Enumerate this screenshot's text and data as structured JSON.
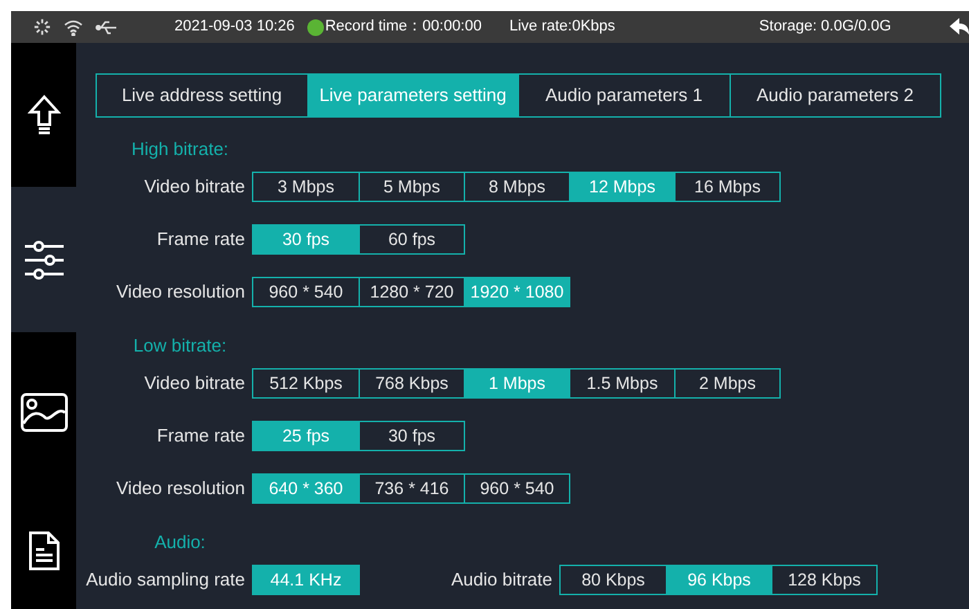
{
  "status_bar": {
    "datetime": "2021-09-03 10:26",
    "record_time": "Record time：00:00:00",
    "live_rate": "Live rate:0Kbps",
    "storage": "Storage: 0.0G/0.0G"
  },
  "sidebar": {
    "items": [
      {
        "kind": "upload",
        "selected": false
      },
      {
        "kind": "sliders",
        "selected": true
      },
      {
        "kind": "image",
        "selected": false
      },
      {
        "kind": "document",
        "selected": false
      }
    ]
  },
  "tabs": [
    {
      "label": "Live address setting",
      "selected": false
    },
    {
      "label": "Live parameters setting",
      "selected": true
    },
    {
      "label": "Audio parameters 1",
      "selected": false
    },
    {
      "label": "Audio parameters 2",
      "selected": false
    }
  ],
  "sections": [
    {
      "title": "High bitrate:",
      "rows": [
        {
          "fields": [
            {
              "label": "Video bitrate",
              "options": [
                {
                  "label": "3 Mbps",
                  "selected": false
                },
                {
                  "label": "5 Mbps",
                  "selected": false
                },
                {
                  "label": "8 Mbps",
                  "selected": false
                },
                {
                  "label": "12 Mbps",
                  "selected": true
                },
                {
                  "label": "16 Mbps",
                  "selected": false
                }
              ]
            }
          ]
        },
        {
          "fields": [
            {
              "label": "Frame rate",
              "options": [
                {
                  "label": "30 fps",
                  "selected": true
                },
                {
                  "label": "60 fps",
                  "selected": false
                }
              ]
            }
          ]
        },
        {
          "fields": [
            {
              "label": "Video resolution",
              "options": [
                {
                  "label": "960 * 540",
                  "selected": false
                },
                {
                  "label": "1280 * 720",
                  "selected": false
                },
                {
                  "label": "1920 * 1080",
                  "selected": true
                }
              ]
            }
          ]
        }
      ]
    },
    {
      "title": "Low bitrate:",
      "rows": [
        {
          "fields": [
            {
              "label": "Video bitrate",
              "options": [
                {
                  "label": "512 Kbps",
                  "selected": false
                },
                {
                  "label": "768 Kbps",
                  "selected": false
                },
                {
                  "label": "1 Mbps",
                  "selected": true
                },
                {
                  "label": "1.5 Mbps",
                  "selected": false
                },
                {
                  "label": "2 Mbps",
                  "selected": false
                }
              ]
            }
          ]
        },
        {
          "fields": [
            {
              "label": "Frame rate",
              "options": [
                {
                  "label": "25 fps",
                  "selected": true
                },
                {
                  "label": "30 fps",
                  "selected": false
                }
              ]
            }
          ]
        },
        {
          "fields": [
            {
              "label": "Video resolution",
              "options": [
                {
                  "label": "640 * 360",
                  "selected": true
                },
                {
                  "label": "736 * 416",
                  "selected": false
                },
                {
                  "label": "960 * 540",
                  "selected": false
                }
              ]
            }
          ]
        }
      ]
    },
    {
      "title": "Audio:",
      "rows": [
        {
          "fields": [
            {
              "label": "Audio sampling rate",
              "options": [
                {
                  "label": "44.1 KHz",
                  "selected": true
                }
              ]
            },
            {
              "label": "Audio bitrate",
              "options": [
                {
                  "label": "80 Kbps",
                  "selected": false
                },
                {
                  "label": "96 Kbps",
                  "selected": true
                },
                {
                  "label": "128 Kbps",
                  "selected": false
                }
              ]
            }
          ]
        }
      ]
    }
  ]
}
